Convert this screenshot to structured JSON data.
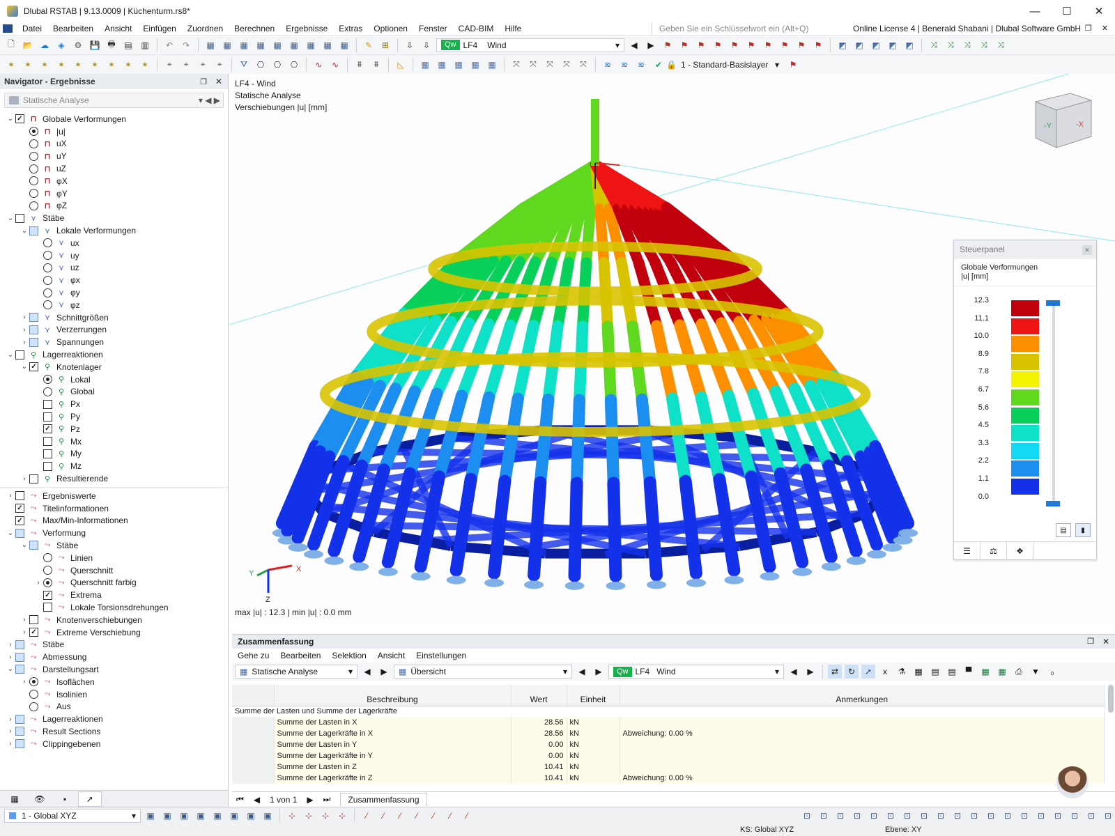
{
  "window": {
    "title": "Dlubal RSTAB | 9.13.0009 | Küchenturm.rs8*"
  },
  "menu": [
    "Datei",
    "Bearbeiten",
    "Ansicht",
    "Einfügen",
    "Zuordnen",
    "Berechnen",
    "Ergebnisse",
    "Extras",
    "Optionen",
    "Fenster",
    "CAD-BIM",
    "Hilfe"
  ],
  "search_placeholder": "Geben Sie ein Schlüsselwort ein (Alt+Q)",
  "license": "Online License 4 | Benerald Shabani | Dlubal Software GmbH",
  "toolbar": {
    "loadcase_badge": "Qw",
    "loadcase_code": "LF4",
    "loadcase_name": "Wind",
    "layer": "1 - Standard-Basislayer"
  },
  "navigator": {
    "title": "Navigator - Ergebnisse",
    "analysis": "Statische Analyse",
    "items": [
      {
        "level": 0,
        "exp": "v",
        "ctl": "cb",
        "state": "on",
        "icon": "def",
        "label": "Globale Verformungen"
      },
      {
        "level": 1,
        "exp": "",
        "ctl": "rb",
        "state": "on",
        "icon": "def",
        "label": "|u|"
      },
      {
        "level": 1,
        "exp": "",
        "ctl": "rb",
        "state": "",
        "icon": "def",
        "label": "uX"
      },
      {
        "level": 1,
        "exp": "",
        "ctl": "rb",
        "state": "",
        "icon": "def",
        "label": "uY"
      },
      {
        "level": 1,
        "exp": "",
        "ctl": "rb",
        "state": "",
        "icon": "def",
        "label": "uZ"
      },
      {
        "level": 1,
        "exp": "",
        "ctl": "rb",
        "state": "",
        "icon": "def",
        "label": "φX"
      },
      {
        "level": 1,
        "exp": "",
        "ctl": "rb",
        "state": "",
        "icon": "def",
        "label": "φY"
      },
      {
        "level": 1,
        "exp": "",
        "ctl": "rb",
        "state": "",
        "icon": "def",
        "label": "φZ"
      },
      {
        "level": 0,
        "exp": "v",
        "ctl": "cb",
        "state": "",
        "icon": "mem",
        "label": "Stäbe"
      },
      {
        "level": 1,
        "exp": "v",
        "ctl": "cb",
        "state": "part",
        "icon": "mem",
        "label": "Lokale Verformungen"
      },
      {
        "level": 2,
        "exp": "",
        "ctl": "rb",
        "state": "",
        "icon": "mem",
        "label": "ux"
      },
      {
        "level": 2,
        "exp": "",
        "ctl": "rb",
        "state": "",
        "icon": "mem",
        "label": "uy"
      },
      {
        "level": 2,
        "exp": "",
        "ctl": "rb",
        "state": "",
        "icon": "mem",
        "label": "uz"
      },
      {
        "level": 2,
        "exp": "",
        "ctl": "rb",
        "state": "",
        "icon": "mem",
        "label": "φx"
      },
      {
        "level": 2,
        "exp": "",
        "ctl": "rb",
        "state": "",
        "icon": "mem",
        "label": "φy"
      },
      {
        "level": 2,
        "exp": "",
        "ctl": "rb",
        "state": "",
        "icon": "mem",
        "label": "φz"
      },
      {
        "level": 1,
        "exp": ">",
        "ctl": "cb",
        "state": "part",
        "icon": "mem",
        "label": "Schnittgrößen"
      },
      {
        "level": 1,
        "exp": ">",
        "ctl": "cb",
        "state": "part",
        "icon": "mem",
        "label": "Verzerrungen"
      },
      {
        "level": 1,
        "exp": ">",
        "ctl": "cb",
        "state": "part",
        "icon": "mem",
        "label": "Spannungen"
      },
      {
        "level": 0,
        "exp": "v",
        "ctl": "cb",
        "state": "",
        "icon": "sup",
        "label": "Lagerreaktionen"
      },
      {
        "level": 1,
        "exp": "v",
        "ctl": "cb",
        "state": "on",
        "icon": "sup",
        "label": "Knotenlager"
      },
      {
        "level": 2,
        "exp": "",
        "ctl": "rb",
        "state": "on",
        "icon": "sup",
        "label": "Lokal"
      },
      {
        "level": 2,
        "exp": "",
        "ctl": "rb",
        "state": "",
        "icon": "sup",
        "label": "Global"
      },
      {
        "level": 2,
        "exp": "",
        "ctl": "cb",
        "state": "",
        "icon": "sup",
        "label": "Px"
      },
      {
        "level": 2,
        "exp": "",
        "ctl": "cb",
        "state": "",
        "icon": "sup",
        "label": "Py"
      },
      {
        "level": 2,
        "exp": "",
        "ctl": "cb",
        "state": "on",
        "icon": "sup",
        "label": "Pz"
      },
      {
        "level": 2,
        "exp": "",
        "ctl": "cb",
        "state": "",
        "icon": "sup",
        "label": "Mx"
      },
      {
        "level": 2,
        "exp": "",
        "ctl": "cb",
        "state": "",
        "icon": "sup",
        "label": "My"
      },
      {
        "level": 2,
        "exp": "",
        "ctl": "cb",
        "state": "",
        "icon": "sup",
        "label": "Mz"
      },
      {
        "level": 1,
        "exp": ">",
        "ctl": "cb",
        "state": "",
        "icon": "sup",
        "label": "Resultierende"
      },
      {
        "level": 0,
        "exp": ">",
        "ctl": "cb",
        "state": "",
        "icon": "res",
        "label": "Ergebniswerte"
      },
      {
        "level": 0,
        "exp": "",
        "ctl": "cb",
        "state": "on",
        "icon": "res",
        "label": "Titelinformationen"
      },
      {
        "level": 0,
        "exp": "",
        "ctl": "cb",
        "state": "on",
        "icon": "res",
        "label": "Max/Min-Informationen"
      },
      {
        "level": 0,
        "exp": "v",
        "ctl": "cb",
        "state": "part",
        "icon": "res",
        "label": "Verformung"
      },
      {
        "level": 1,
        "exp": "v",
        "ctl": "cb",
        "state": "part",
        "icon": "res",
        "label": "Stäbe"
      },
      {
        "level": 2,
        "exp": "",
        "ctl": "rb",
        "state": "",
        "icon": "res",
        "label": "Linien"
      },
      {
        "level": 2,
        "exp": "",
        "ctl": "rb",
        "state": "",
        "icon": "res",
        "label": "Querschnitt"
      },
      {
        "level": 2,
        "exp": ">",
        "ctl": "rb",
        "state": "on",
        "icon": "res",
        "label": "Querschnitt farbig"
      },
      {
        "level": 2,
        "exp": "",
        "ctl": "cb",
        "state": "on",
        "icon": "res",
        "label": "Extrema"
      },
      {
        "level": 2,
        "exp": "",
        "ctl": "cb",
        "state": "",
        "icon": "res",
        "label": "Lokale Torsionsdrehungen"
      },
      {
        "level": 1,
        "exp": ">",
        "ctl": "cb",
        "state": "",
        "icon": "res",
        "label": "Knotenverschiebungen"
      },
      {
        "level": 1,
        "exp": ">",
        "ctl": "cb",
        "state": "on",
        "icon": "res",
        "label": "Extreme Verschiebung"
      },
      {
        "level": 0,
        "exp": ">",
        "ctl": "cb",
        "state": "part",
        "icon": "res",
        "label": "Stäbe"
      },
      {
        "level": 0,
        "exp": ">",
        "ctl": "cb",
        "state": "part",
        "icon": "res",
        "label": "Abmessung"
      },
      {
        "level": 0,
        "exp": "v",
        "ctl": "cb",
        "state": "part",
        "icon": "res",
        "label": "Darstellungsart"
      },
      {
        "level": 1,
        "exp": ">",
        "ctl": "rb",
        "state": "on",
        "icon": "res",
        "label": "Isoflächen"
      },
      {
        "level": 1,
        "exp": "",
        "ctl": "rb",
        "state": "",
        "icon": "res",
        "label": "Isolinien"
      },
      {
        "level": 1,
        "exp": "",
        "ctl": "rb",
        "state": "",
        "icon": "res",
        "label": "Aus"
      },
      {
        "level": 0,
        "exp": ">",
        "ctl": "cb",
        "state": "part",
        "icon": "res",
        "label": "Lagerreaktionen"
      },
      {
        "level": 0,
        "exp": ">",
        "ctl": "cb",
        "state": "part",
        "icon": "res",
        "label": "Result Sections"
      },
      {
        "level": 0,
        "exp": ">",
        "ctl": "cb",
        "state": "part",
        "icon": "res",
        "label": "Clippingebenen"
      }
    ]
  },
  "viewport": {
    "title_lines": [
      "LF4 - Wind",
      "Statische Analyse",
      "Verschiebungen |u| [mm]"
    ],
    "maxmin": "max |u| : 12.3 | min |u| : 0.0 mm",
    "axis": {
      "x": "X",
      "y": "Y",
      "z": "Z"
    },
    "cube_labels": [
      "-Y",
      "-X"
    ]
  },
  "control_panel": {
    "title": "Steuerpanel",
    "heading": "Globale Verformungen",
    "unit": "|u| [mm]",
    "legend": [
      {
        "value": "12.3",
        "color": "#c0000c"
      },
      {
        "value": "11.1",
        "color": "#ee1414"
      },
      {
        "value": "10.0",
        "color": "#fb8f00"
      },
      {
        "value": "8.9",
        "color": "#d8c300"
      },
      {
        "value": "7.8",
        "color": "#f3f300"
      },
      {
        "value": "6.7",
        "color": "#5fd81e"
      },
      {
        "value": "5.6",
        "color": "#08d05a"
      },
      {
        "value": "4.5",
        "color": "#0fe0c8"
      },
      {
        "value": "3.3",
        "color": "#14d9f4"
      },
      {
        "value": "2.2",
        "color": "#1c8ef0"
      },
      {
        "value": "1.1",
        "color": "#1431ea"
      },
      {
        "value": "0.0",
        "color": "#0a1ea0"
      }
    ]
  },
  "summary": {
    "title": "Zusammenfassung",
    "menu": [
      "Gehe zu",
      "Bearbeiten",
      "Selektion",
      "Ansicht",
      "Einstellungen"
    ],
    "analysis": "Statische Analyse",
    "view": "Übersicht",
    "columns": [
      "Beschreibung",
      "Wert",
      "Einheit",
      "Anmerkungen"
    ],
    "group": "Summe der Lasten und Summe der Lagerkräfte",
    "rows": [
      {
        "desc": "Summe der Lasten in X",
        "value": "28.56",
        "unit": "kN",
        "note": ""
      },
      {
        "desc": "Summe der Lagerkräfte in X",
        "value": "28.56",
        "unit": "kN",
        "note": "Abweichung: 0.00 %"
      },
      {
        "desc": "Summe der Lasten in Y",
        "value": "0.00",
        "unit": "kN",
        "note": ""
      },
      {
        "desc": "Summe der Lagerkräfte in Y",
        "value": "0.00",
        "unit": "kN",
        "note": ""
      },
      {
        "desc": "Summe der Lasten in Z",
        "value": "10.41",
        "unit": "kN",
        "note": ""
      },
      {
        "desc": "Summe der Lagerkräfte in Z",
        "value": "10.41",
        "unit": "kN",
        "note": "Abweichung: 0.00 %"
      }
    ],
    "pager": "1 von 1",
    "tab": "Zusammenfassung"
  },
  "status": {
    "coord_system": "1 - Global XYZ",
    "ks": "KS: Global XYZ",
    "plane": "Ebene: XY"
  }
}
